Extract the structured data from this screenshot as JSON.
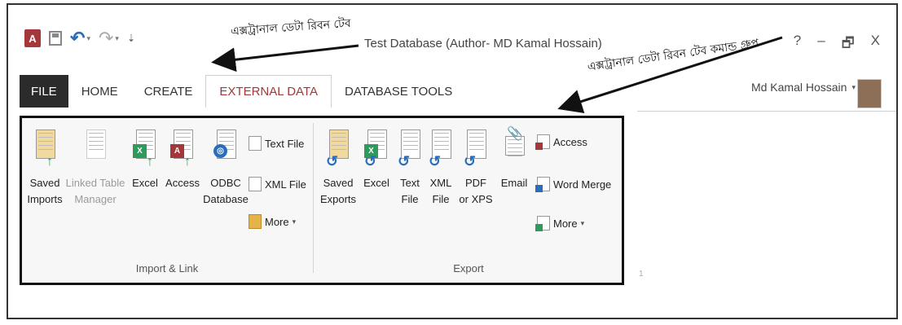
{
  "window": {
    "title": "Test Database (Author- MD Kamal Hossain)",
    "help": "?",
    "minimize": "–",
    "restore": "🗗",
    "close": "X"
  },
  "qat": {
    "app_icon": "A",
    "save_icon": "save-icon",
    "undo_icon": "↶",
    "redo_icon": "↷",
    "customize": "⇣"
  },
  "annotations": {
    "tab_note": "এক্সট্রানাল ডেটা রিবন টেব",
    "group_note": "এক্সট্রানাল ডেটা রিবন টেব কমান্ড গ্রুপ"
  },
  "tabs": [
    {
      "label": "FILE"
    },
    {
      "label": "HOME"
    },
    {
      "label": "CREATE"
    },
    {
      "label": "EXTERNAL DATA"
    },
    {
      "label": "DATABASE TOOLS"
    }
  ],
  "user": {
    "name": "Md Kamal Hossain",
    "caret": "▾"
  },
  "groups": {
    "import": {
      "label": "Import & Link",
      "saved_imports": {
        "line1": "Saved",
        "line2": "Imports"
      },
      "linked_table": {
        "line1": "Linked Table",
        "line2": "Manager"
      },
      "excel": {
        "line1": "Excel",
        "badge": "X"
      },
      "access": {
        "line1": "Access",
        "badge": "A"
      },
      "odbc": {
        "line1": "ODBC",
        "line2": "Database"
      },
      "text_file": "Text File",
      "xml_file": "XML File",
      "more": "More"
    },
    "export": {
      "label": "Export",
      "saved_exports": {
        "line1": "Saved",
        "line2": "Exports"
      },
      "excel": {
        "line1": "Excel",
        "badge": "X"
      },
      "text_file": {
        "line1": "Text",
        "line2": "File"
      },
      "xml_file": {
        "line1": "XML",
        "line2": "File"
      },
      "pdf": {
        "line1": "PDF",
        "line2": "or XPS"
      },
      "email": {
        "line1": "Email"
      },
      "access": "Access",
      "word_merge": "Word Merge",
      "more": "More"
    }
  },
  "colors": {
    "access_red": "#a4373a",
    "excel_green": "#2f9a5b",
    "word_blue": "#2a6ebb",
    "file_tab": "#2b2b2b"
  },
  "right_panel_mark": "1"
}
